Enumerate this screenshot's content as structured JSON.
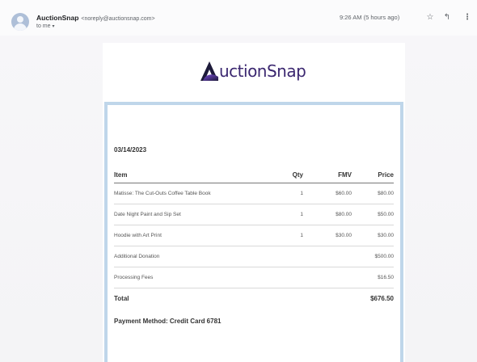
{
  "email": {
    "sender_name": "AuctionSnap",
    "sender_email": "<noreply@auctionsnap.com>",
    "to_label": "to me",
    "timestamp": "9:26 AM (5 hours ago)",
    "icons": [
      "star-icon",
      "reply-icon",
      "more-vert-icon"
    ]
  },
  "brand": {
    "logo_text": "uctionSnap",
    "logo_letter_mark": "A",
    "colors": {
      "logo_text": "#3b2770",
      "logo_mark_dark": "#1d1a3a",
      "logo_mark_accent": "#7a4bd6",
      "receipt_border": "#bfd6ea"
    }
  },
  "receipt": {
    "date": "03/14/2023",
    "columns": {
      "item": "Item",
      "qty": "Qty",
      "fmv": "FMV",
      "price": "Price"
    },
    "rows": [
      {
        "item": "Matisse: The Cut-Outs Coffee Table Book",
        "qty": "1",
        "fmv": "$60.00",
        "price": "$80.00"
      },
      {
        "item": "Date Night Paint and Sip Set",
        "qty": "1",
        "fmv": "$80.00",
        "price": "$50.00"
      },
      {
        "item": "Hoodie with Art Print",
        "qty": "1",
        "fmv": "$30.00",
        "price": "$30.00"
      },
      {
        "item": "Additional Donation",
        "qty": "",
        "fmv": "",
        "price": "$500.00"
      },
      {
        "item": "Processing Fees",
        "qty": "",
        "fmv": "",
        "price": "$16.50"
      }
    ],
    "total_label": "Total",
    "total_value": "$676.50",
    "payment_method": "Payment Method: Credit Card 6781"
  }
}
